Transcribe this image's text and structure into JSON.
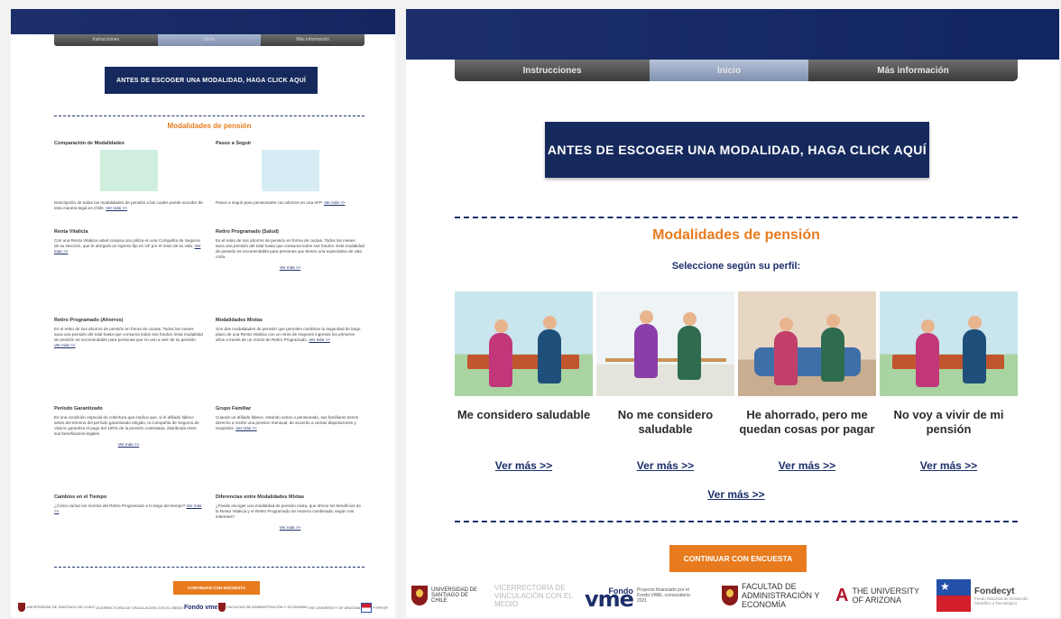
{
  "nav": {
    "items": [
      "Instrucciones",
      "Inicio",
      "Más información"
    ],
    "active": "Inicio"
  },
  "cta": "ANTES DE ESCOGER UNA MODALIDAD, HAGA CLICK AQUÍ",
  "left": {
    "title": "Modalidades de pensión",
    "more": "Ver más >>",
    "continue": "CONTINUAR CON ENCUESTA",
    "cards": [
      {
        "title": "Comparación de Modalidades",
        "desc": "Descripción de todas las modalidades de pensión a las cuales puede acceder de esta manera legal en Chile."
      },
      {
        "title": "Pasos a Seguir",
        "desc": "Pasos a seguir para pensionarse con ahorros en una AFP."
      },
      {
        "title": "Renta Vitalicia",
        "desc": "Con una Renta Vitalicia usted compra una póliza en una Compañía de Seguros de su elección, que le otorgará un ingreso fijo en UF por el resto de su vida."
      },
      {
        "title": "Retiro Programado (Salud)",
        "desc": "Es el retiro de sus ahorros de pensión en forma de cuotas. Todos los meses saca una pensión del total hasta que consuma todos sus fondos. Esta modalidad de pensión es recomendable para personas que tienen una expectativa de vida corta."
      },
      {
        "title": "Retiro Programado (Ahorros)",
        "desc": "Es el retiro de sus ahorros de pensión en forma de cuotas. Todos los meses saca una pensión del total hasta que consuma todos sus fondos. Esta modalidad de pensión es recomendable para personas que no van a vivir de su pensión."
      },
      {
        "title": "Modalidades Mixtas",
        "desc": "Son dos modalidades de pensión que permiten combinar la seguridad de largo plazo de una Renta Vitalicia con un retiro de mayores ingresos los primeros años a través de un monto de Retiro Programado."
      },
      {
        "title": "Período Garantizado",
        "desc": "Es una condición especial de cobertura que implica que, si el afiliado fallece antes del término del período garantizado elegido, la Compañía de Seguros de Vida le garantiza el pago del 100% de la pensión contratada, distribuida entre sus beneficiarios legales."
      },
      {
        "title": "Grupo Familiar",
        "desc": "Cuando un afiliado fallece, estando activo o pensionado, sus familiares tienen derecho a recibir una pensión mensual, de acuerdo a ciertas disposiciones y requisitos."
      },
      {
        "title": "Cambios en el Tiempo",
        "desc": "¿Cómo varían los montos del Retiro Programado a lo largo del tiempo?"
      },
      {
        "title": "Diferencias entre Modalidades Mixtas",
        "desc": "¿Puedo escoger una modalidad de pensión mixta, que ofrece los beneficios de la Renta Vitalicia y el Retiro Programado de manera combinada, según mis intereses?"
      }
    ]
  },
  "right": {
    "title": "Modalidades de pensión",
    "subtitle": "Seleccione según su perfil:",
    "profiles": [
      {
        "label": "Me considero saludable",
        "more": "Ver más >>"
      },
      {
        "label": "No me considero saludable",
        "more": "Ver más >>"
      },
      {
        "label": "He ahorrado, pero me quedan cosas por pagar",
        "more": "Ver más >>"
      },
      {
        "label": "No voy a vivir de mi pensión",
        "more": "Ver más >>"
      }
    ],
    "more": "Ver más >>",
    "continue": "CONTINUAR CON ENCUESTA"
  },
  "footer": {
    "usach": "UNIVERSIDAD DE SANTIAGO DE CHILE",
    "vime": "VICERRECTORÍA DE VINCULACIÓN CON EL MEDIO",
    "fondo_small": "Fondo",
    "fondo_big": "vme",
    "fondo_note": "Proyecto financiado por el Fondo VIME, convocatoria 2021",
    "fae": "FACULTAD DE ADMINISTRACIÓN Y ECONOMÍA",
    "ua_mark": "A",
    "ua": "THE UNIVERSITY OF ARIZONA",
    "fondecyt": "Fondecyt",
    "fondecyt_sub": "Fondo Nacional de Desarrollo Científico y Tecnológico"
  },
  "colors": {
    "navy": "#1c2f6b",
    "orange": "#e87b1e",
    "nav_gray": "#4a4a4a"
  }
}
